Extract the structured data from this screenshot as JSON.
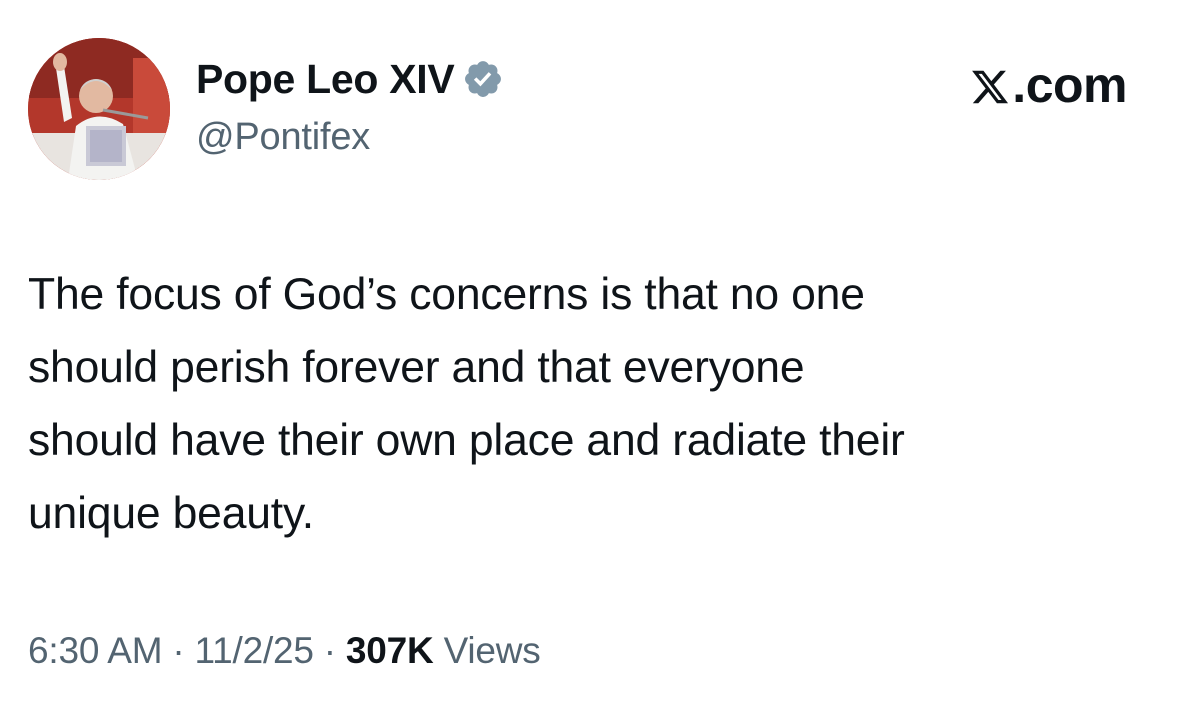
{
  "author": {
    "display_name": "Pope Leo XIV",
    "handle": "@Pontifex",
    "verified": true,
    "verified_badge_color": "#829aab",
    "avatar_icon": "avatar-photo"
  },
  "site": {
    "label_suffix": ".com",
    "logo_icon": "x-logo-icon"
  },
  "tweet": {
    "text_lines": [
      "The focus of God’s concerns is that no one",
      "should perish forever and that everyone",
      "should have their own place and radiate their",
      "unique beauty."
    ]
  },
  "meta": {
    "time": "6:30 AM",
    "separator": "·",
    "date": "11/2/25",
    "views_count": "307K",
    "views_label": "Views"
  },
  "colors": {
    "text_primary": "#0f1419",
    "text_secondary": "#536471",
    "background": "#ffffff"
  }
}
